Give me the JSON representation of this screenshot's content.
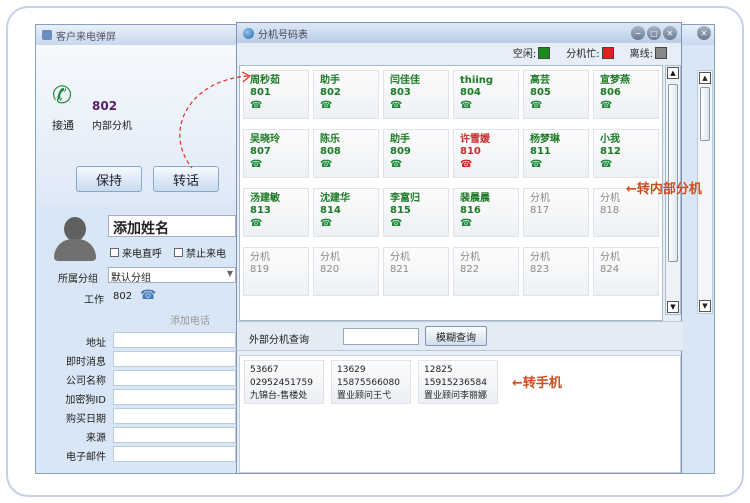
{
  "back_window": {
    "title": "客户来电弹屏",
    "ext_number": "802",
    "ext_desc": "内部分机",
    "connect_label": "接通",
    "hold_label": "保持",
    "transfer_label": "转话",
    "name_placeholder": "添加姓名",
    "chk_direct_call": "来电直呼",
    "chk_block_call": "禁止来电",
    "group_label": "所属分组",
    "group_value": "默认分组",
    "work_label": "工作",
    "work_value": "802",
    "add_phone_label": "添加电话",
    "fields": [
      "地址",
      "即时消息",
      "公司名称",
      "加密狗ID",
      "购买日期",
      "来源",
      "电子邮件"
    ]
  },
  "dialog": {
    "title": "分机号码表",
    "legend": {
      "idle": "空闲:",
      "busy": "分机忙:",
      "offline": "离线:",
      "idle_color": "#1e8a1e",
      "busy_color": "#e02020",
      "offline_color": "#888888"
    },
    "extensions": [
      {
        "name": "周秒茹",
        "number": "801",
        "status": "free"
      },
      {
        "name": "助手",
        "number": "802",
        "status": "free"
      },
      {
        "name": "闫佳佳",
        "number": "803",
        "status": "free"
      },
      {
        "name": "thiing",
        "number": "804",
        "status": "free"
      },
      {
        "name": "高芸",
        "number": "805",
        "status": "free"
      },
      {
        "name": "宣梦燕",
        "number": "806",
        "status": "free"
      },
      {
        "name": "吴晓玲",
        "number": "807",
        "status": "free"
      },
      {
        "name": "陈乐",
        "number": "808",
        "status": "free"
      },
      {
        "name": "助手",
        "number": "809",
        "status": "free"
      },
      {
        "name": "许雪媛",
        "number": "810",
        "status": "busy"
      },
      {
        "name": "杨梦琳",
        "number": "811",
        "status": "free"
      },
      {
        "name": "小我",
        "number": "812",
        "status": "free"
      },
      {
        "name": "汤建敏",
        "number": "813",
        "status": "free"
      },
      {
        "name": "沈建华",
        "number": "814",
        "status": "free"
      },
      {
        "name": "李富归",
        "number": "815",
        "status": "free"
      },
      {
        "name": "裴晨晨",
        "number": "816",
        "status": "free"
      },
      {
        "name": "分机",
        "number": "817",
        "status": "offline"
      },
      {
        "name": "分机",
        "number": "818",
        "status": "offline"
      },
      {
        "name": "分机",
        "number": "819",
        "status": "offline"
      },
      {
        "name": "分机",
        "number": "820",
        "status": "offline"
      },
      {
        "name": "分机",
        "number": "821",
        "status": "offline"
      },
      {
        "name": "分机",
        "number": "822",
        "status": "offline"
      },
      {
        "name": "分机",
        "number": "823",
        "status": "offline"
      },
      {
        "name": "分机",
        "number": "824",
        "status": "offline"
      }
    ],
    "search_label": "外部分机查询",
    "search_button": "模糊查询",
    "external": [
      {
        "id": "53667",
        "phone": "02952451759",
        "name": "九锦台-售楼处"
      },
      {
        "id": "13629",
        "phone": "15875566080",
        "name": "置业顾问王弋"
      },
      {
        "id": "12825",
        "phone": "15915236584",
        "name": "置业顾问李丽娜"
      }
    ]
  },
  "annotations": {
    "internal": "←转内部分机",
    "mobile": "←转手机"
  }
}
